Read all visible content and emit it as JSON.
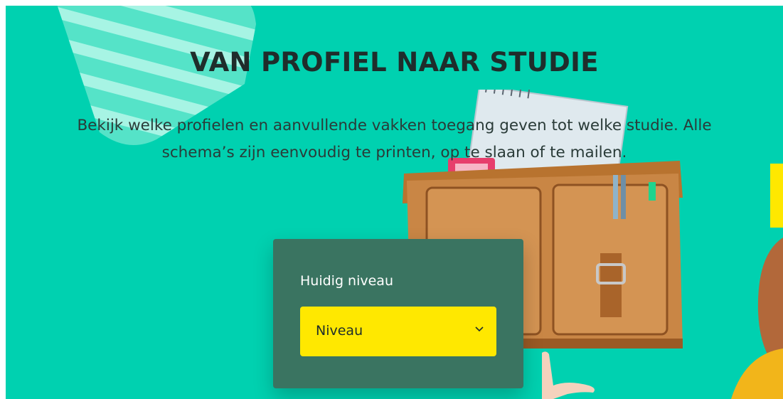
{
  "hero": {
    "title": "VAN PROFIEL NAAR STUDIE",
    "description": "Bekijk welke profielen en aanvullende vakken toegang geven tot welke studie. Alle schema’s zijn eenvoudig te printen, op te slaan of te mailen."
  },
  "level_form": {
    "label": "Huidig niveau",
    "select_value": "Niveau"
  },
  "colors": {
    "background": "#00d1b0",
    "card": "#3a7461",
    "select": "#ffe800",
    "heading": "#1f2d2b"
  },
  "icons": {
    "select_indicator": "chevron-down-icon"
  }
}
